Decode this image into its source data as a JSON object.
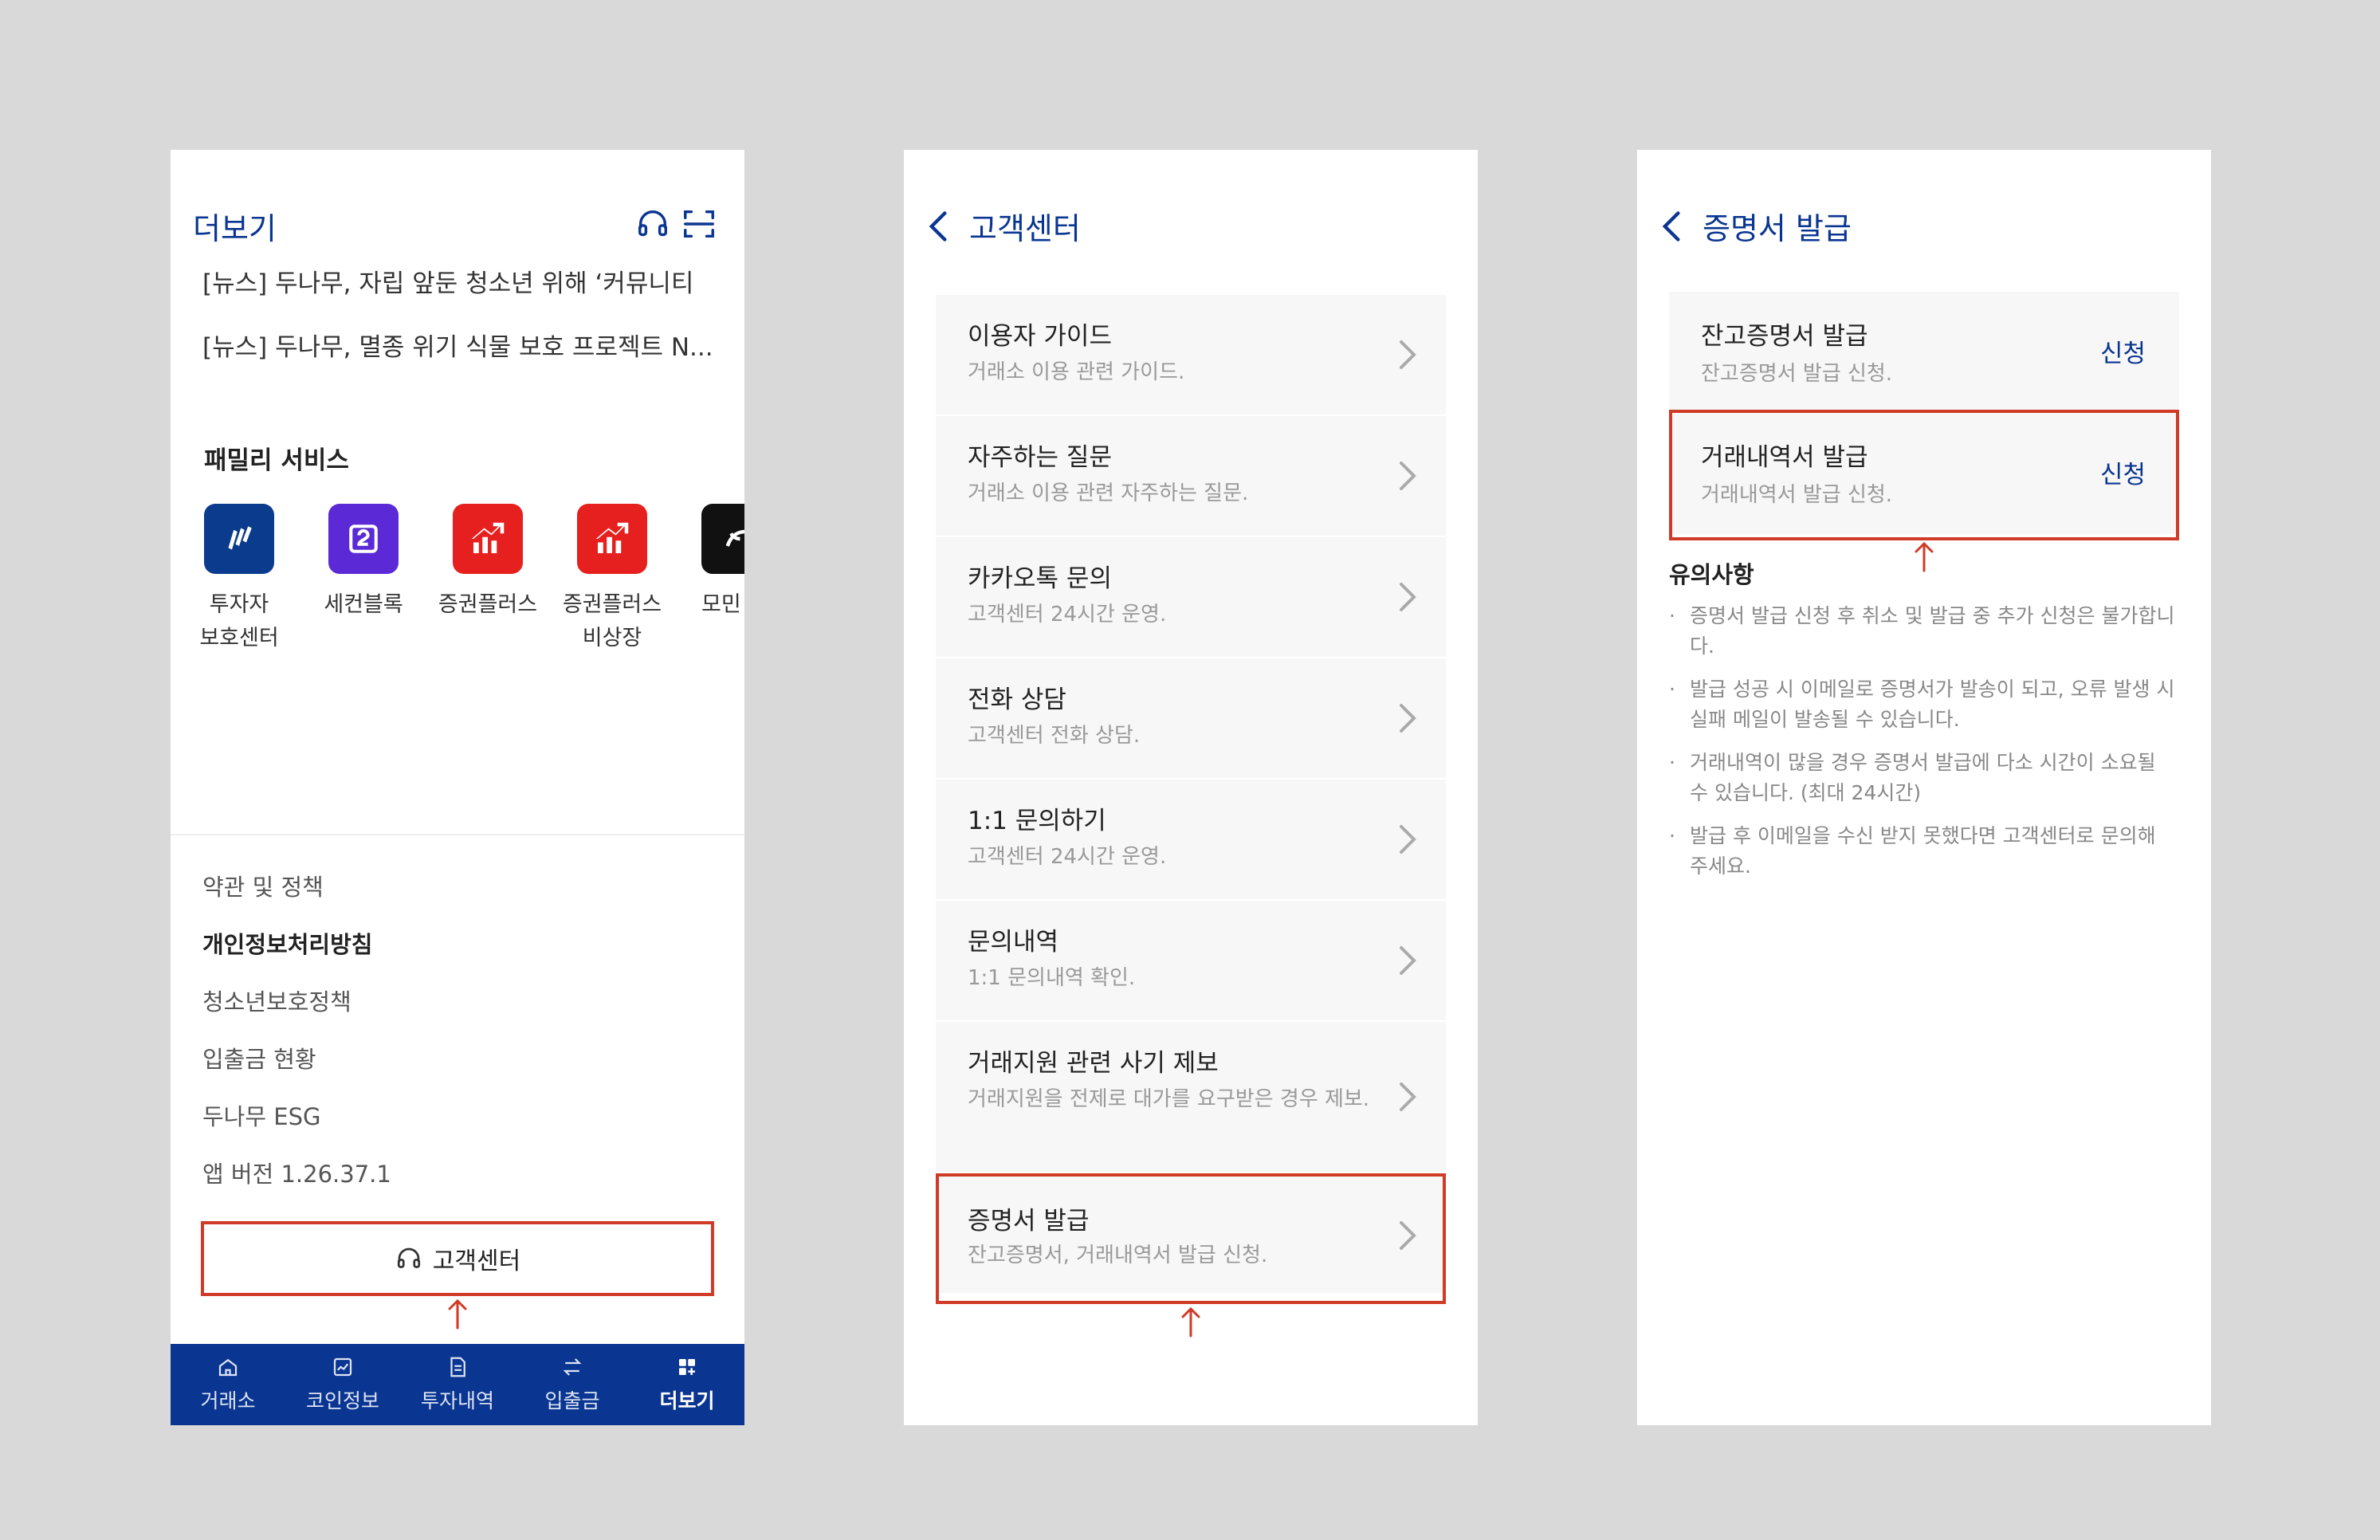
{
  "panel1": {
    "title": "더보기",
    "news": [
      "[뉴스] 두나무, 자립 앞둔 청소년 위해 ‘커뮤니티",
      "[뉴스] 두나무, 멸종 위기 식물 보호 프로젝트 N..."
    ],
    "family_title": "패밀리 서비스",
    "family": [
      {
        "label": "투자자\n보호센터",
        "color": "#0b3b8c"
      },
      {
        "label": "세컨블록",
        "color": "#5b2ad6"
      },
      {
        "label": "증권플러스",
        "color": "#e5201f"
      },
      {
        "label": "증권플러스\n비상장",
        "color": "#e5201f"
      },
      {
        "label": "모민",
        "color": "#111111"
      }
    ],
    "policies": [
      "약관 및 정책",
      "개인정보처리방침",
      "청소년보호정책",
      "입출금 현황",
      "두나무 ESG",
      "앱 버전 1.26.37.1"
    ],
    "cs_button": "고객센터",
    "nav": [
      "거래소",
      "코인정보",
      "투자내역",
      "입출금",
      "더보기"
    ]
  },
  "panel2": {
    "title": "고객센터",
    "items": [
      {
        "title": "이용자 가이드",
        "sub": "거래소 이용 관련 가이드."
      },
      {
        "title": "자주하는 질문",
        "sub": "거래소 이용 관련 자주하는 질문."
      },
      {
        "title": "카카오톡 문의",
        "sub": "고객센터 24시간 운영."
      },
      {
        "title": "전화 상담",
        "sub": "고객센터 전화 상담."
      },
      {
        "title": "1:1 문의하기",
        "sub": "고객센터 24시간 운영."
      },
      {
        "title": "문의내역",
        "sub": "1:1 문의내역 확인."
      },
      {
        "title": "거래지원 관련 사기 제보",
        "sub": "거래지원을 전제로 대가를 요구받은 경우 제보."
      },
      {
        "title": "증명서 발급",
        "sub": "잔고증명서, 거래내역서 발급 신청."
      }
    ]
  },
  "panel3": {
    "title": "증명서 발급",
    "items": [
      {
        "title": "잔고증명서 발급",
        "sub": "잔고증명서 발급 신청.",
        "action": "신청"
      },
      {
        "title": "거래내역서 발급",
        "sub": "거래내역서 발급 신청.",
        "action": "신청"
      }
    ],
    "notice_title": "유의사항",
    "notices": [
      "증명서 발급 신청 후 취소 및 발급 중 추가 신청은 불가합니다.",
      "발급 성공 시 이메일로 증명서가 발송이 되고, 오류 발생 시 실패 메일이 발송될 수 있습니다.",
      "거래내역이 많을 경우 증명서 발급에 다소 시간이 소요될 수 있습니다. (최대 24시간)",
      "발급 후 이메일을 수신 받지 못했다면 고객센터로 문의해 주세요."
    ]
  },
  "colors": {
    "brand_navy": "#0a3591",
    "highlight_red": "#d03b27",
    "background": "#d9d9d9"
  }
}
